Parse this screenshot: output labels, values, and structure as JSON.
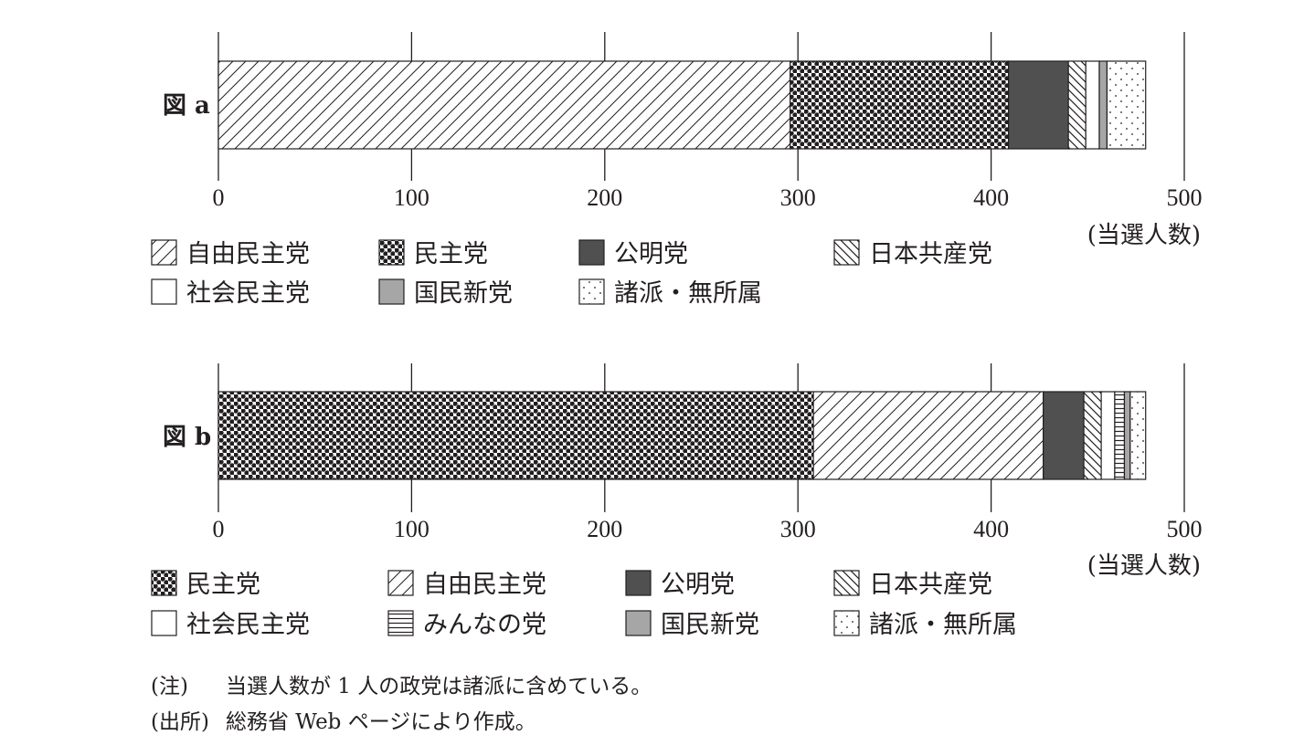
{
  "colors": {
    "ink": "#231f20",
    "dark_fill": "#505050",
    "gray_fill": "#a6a6a6",
    "background": "#ffffff"
  },
  "chart_data": [
    {
      "type": "bar",
      "orientation": "horizontal-stacked",
      "label": "図 a",
      "xlim": [
        0,
        500
      ],
      "xticks": [
        "0",
        "100",
        "200",
        "300",
        "400",
        "500"
      ],
      "unit_label": "(当選人数)",
      "grid": true,
      "series": [
        {
          "name": "自由民主党",
          "value": 296,
          "pattern": "hatch-forward"
        },
        {
          "name": "民主党",
          "value": 113,
          "pattern": "dots-dense"
        },
        {
          "name": "公明党",
          "value": 31,
          "pattern": "solid-dark"
        },
        {
          "name": "日本共産党",
          "value": 9,
          "pattern": "hatch-backward"
        },
        {
          "name": "社会民主党",
          "value": 7,
          "pattern": "white"
        },
        {
          "name": "国民新党",
          "value": 4,
          "pattern": "solid-gray"
        },
        {
          "name": "諸派・無所属",
          "value": 20,
          "pattern": "dots-sparse"
        }
      ]
    },
    {
      "type": "bar",
      "orientation": "horizontal-stacked",
      "label": "図 b",
      "xlim": [
        0,
        500
      ],
      "xticks": [
        "0",
        "100",
        "200",
        "300",
        "400",
        "500"
      ],
      "unit_label": "(当選人数)",
      "grid": true,
      "series": [
        {
          "name": "民主党",
          "value": 308,
          "pattern": "dots-dense"
        },
        {
          "name": "自由民主党",
          "value": 119,
          "pattern": "hatch-forward"
        },
        {
          "name": "公明党",
          "value": 21,
          "pattern": "solid-dark"
        },
        {
          "name": "日本共産党",
          "value": 9,
          "pattern": "hatch-backward"
        },
        {
          "name": "社会民主党",
          "value": 7,
          "pattern": "white"
        },
        {
          "name": "みんなの党",
          "value": 5,
          "pattern": "horizontal-lines"
        },
        {
          "name": "国民新党",
          "value": 3,
          "pattern": "solid-gray"
        },
        {
          "name": "諸派・無所属",
          "value": 8,
          "pattern": "dots-sparse"
        }
      ]
    }
  ],
  "notes": [
    {
      "label": "(注)",
      "text": "当選人数が 1 人の政党は諸派に含めている。"
    },
    {
      "label": "(出所)",
      "text": "総務省 Web ページにより作成。"
    }
  ]
}
